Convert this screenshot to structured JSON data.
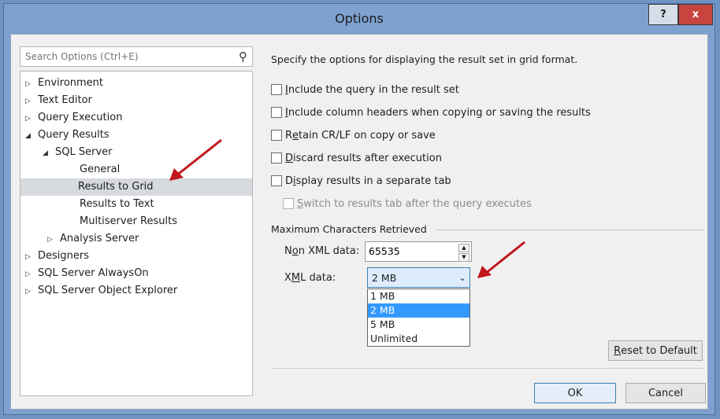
{
  "window": {
    "title": "Options",
    "help_label": "?",
    "close_label": "x"
  },
  "search": {
    "placeholder": "Search Options (Ctrl+E)"
  },
  "tree": {
    "environment": "Environment",
    "text_editor": "Text Editor",
    "query_execution": "Query Execution",
    "query_results": "Query Results",
    "sql_server": "SQL Server",
    "general": "General",
    "results_to_grid": "Results to Grid",
    "results_to_text": "Results to Text",
    "multiserver_results": "Multiserver Results",
    "analysis_server": "Analysis Server",
    "designers": "Designers",
    "sql_server_alwayson": "SQL Server AlwaysOn",
    "sql_server_object_explorer": "SQL Server Object Explorer"
  },
  "panel": {
    "description": "Specify the options for displaying the result set in grid format.",
    "include_query": {
      "key": "I",
      "rest": "nclude the query in the result set"
    },
    "include_headers": {
      "key": "I",
      "rest": "nclude column headers when copying or saving the results"
    },
    "retain_crlf": {
      "pre": "R",
      "key": "e",
      "rest": "tain CR/LF on copy or save"
    },
    "discard_results": {
      "key": "D",
      "rest": "iscard results after execution"
    },
    "separate_tab": {
      "pre": "D",
      "key": "i",
      "rest": "splay results in a separate tab"
    },
    "switch_tab": {
      "key": "S",
      "rest": "witch to results tab after the query executes"
    },
    "max_chars_group": "Maximum Characters Retrieved",
    "non_xml": {
      "pre": "N",
      "key": "o",
      "rest": "n XML data:"
    },
    "non_xml_value": "65535",
    "xml": {
      "pre": "X",
      "key": "M",
      "rest": "L data:"
    },
    "xml_selected": "2 MB",
    "xml_options": [
      "1 MB",
      "2 MB",
      "5 MB",
      "Unlimited"
    ],
    "reset_pre": "",
    "reset_key": "R",
    "reset_rest": "eset to Default",
    "ok_label": "OK",
    "cancel_label": "Cancel"
  },
  "colors": {
    "annotation_arrow": "#c0161c",
    "highlight": "#3399ff"
  }
}
